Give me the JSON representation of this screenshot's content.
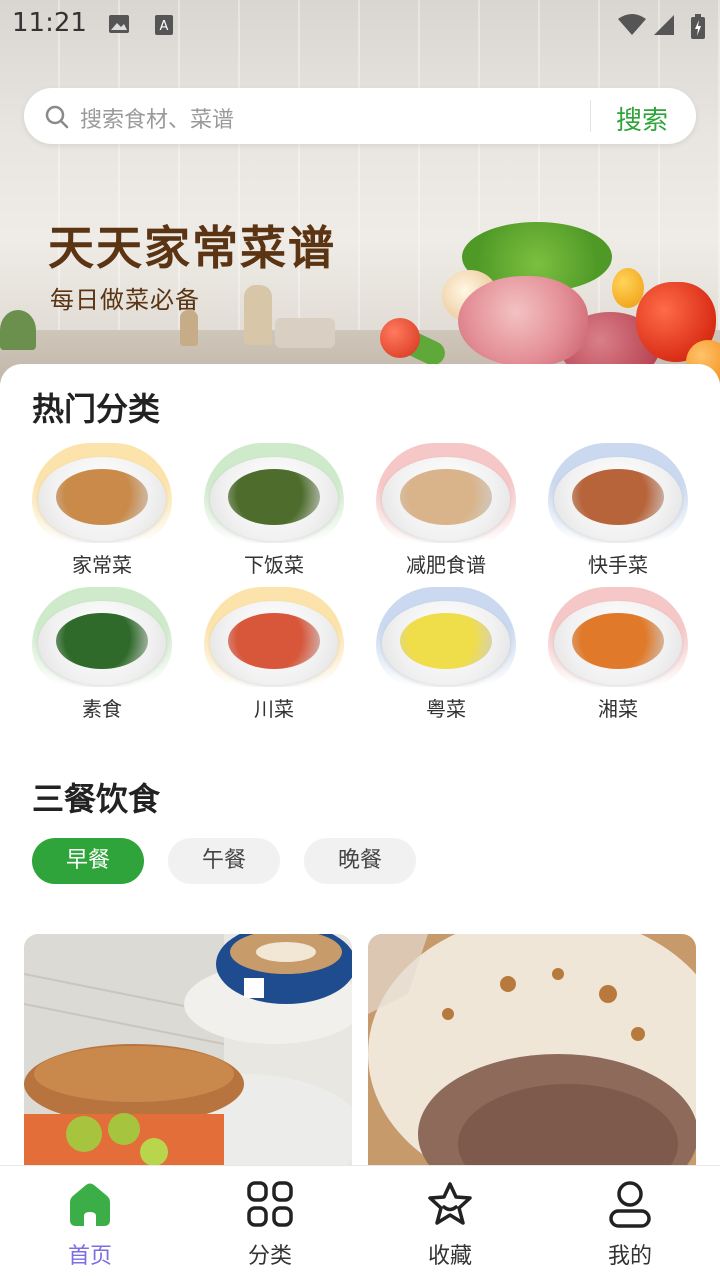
{
  "status_bar": {
    "time": "11:21"
  },
  "search": {
    "placeholder": "搜索食材、菜谱",
    "button": "搜索"
  },
  "banner": {
    "title": "天天家常菜谱",
    "subtitle": "每日做菜必备"
  },
  "hot_categories": {
    "title": "热门分类",
    "items": [
      {
        "label": "家常菜",
        "bg": "#fbe3ab",
        "food": "#c98a4a"
      },
      {
        "label": "下饭菜",
        "bg": "#cfeacb",
        "food": "#4e6d2c"
      },
      {
        "label": "减肥食谱",
        "bg": "#f6c7c7",
        "food": "#d9b48a"
      },
      {
        "label": "快手菜",
        "bg": "#cad9ef",
        "food": "#b8643a"
      },
      {
        "label": "素食",
        "bg": "#cfeacb",
        "food": "#2f6a2a"
      },
      {
        "label": "川菜",
        "bg": "#fbe3ab",
        "food": "#d8563a"
      },
      {
        "label": "粤菜",
        "bg": "#cad9ef",
        "food": "#f0dd4a"
      },
      {
        "label": "湘菜",
        "bg": "#f6c7c7",
        "food": "#e07a2a"
      }
    ]
  },
  "meals": {
    "title": "三餐饮食",
    "tabs": [
      "早餐",
      "午餐",
      "晚餐"
    ],
    "active_tab": "早餐"
  },
  "bottom_nav": {
    "items": [
      "首页",
      "分类",
      "收藏",
      "我的"
    ],
    "active": "首页",
    "active_color": "#7a6ee6",
    "home_icon_color": "#3cae47"
  }
}
